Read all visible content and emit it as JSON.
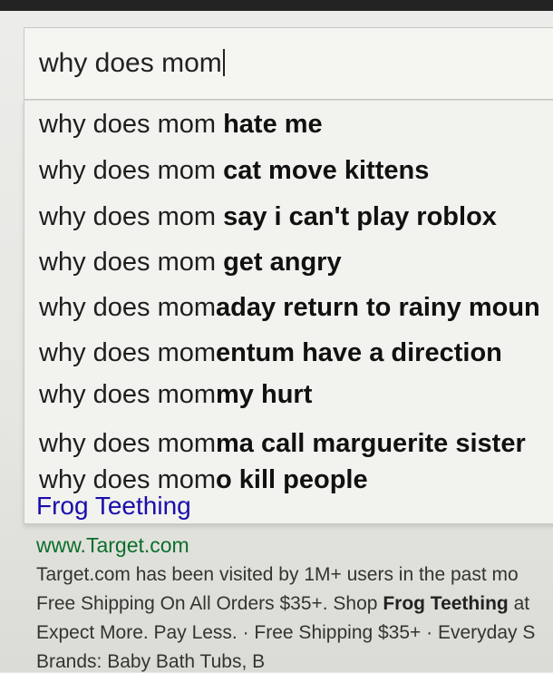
{
  "search": {
    "query": "why does mom"
  },
  "suggestions": [
    {
      "typed": "why does mom",
      "completion": " hate me"
    },
    {
      "typed": "why does mom",
      "completion": " cat move kittens"
    },
    {
      "typed": "why does mom",
      "completion": " say i can't play roblox"
    },
    {
      "typed": "why does mom",
      "completion": " get angry"
    },
    {
      "typed": "why does mom",
      "completion": "aday return to rainy moun"
    },
    {
      "typed": "why does mom",
      "completion": "entum have a direction"
    },
    {
      "typed": "why does mom",
      "completion": "my hurt"
    },
    {
      "typed": "why does mom",
      "completion": "ma call marguerite sister"
    },
    {
      "typed": "why does mom",
      "completion": "o kill people"
    }
  ],
  "result": {
    "title": "Frog Teething",
    "url": "www.Target.com",
    "line1": "Target.com has been visited by 1M+ users in the past mo",
    "line2_prefix": "Free Shipping On All Orders $35+. Shop ",
    "line2_bold": "Frog Teething",
    "line2_suffix": " at",
    "line3": "Expect More. Pay Less. · Free Shipping $35+ · Everyday S",
    "line4": "Brands: Baby Bath Tubs, B"
  }
}
